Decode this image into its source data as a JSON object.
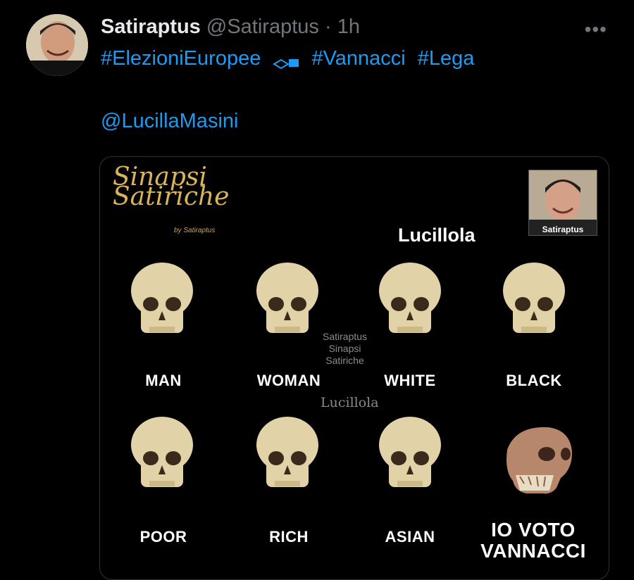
{
  "tweet": {
    "author_name": "Satiraptus",
    "author_handle": "@Satiraptus",
    "separator": "·",
    "time": "1h",
    "more_label": "•••",
    "hashtags": [
      "#ElezioniEuropee",
      "#Vannacci",
      "#Lega"
    ],
    "mention": "@LucillaMasini"
  },
  "image": {
    "logo_title": "Sinapsi Satiriche",
    "logo_line1": "Sinapsi",
    "logo_line2": "Satiriche",
    "logo_byline": "by Satiraptus",
    "header_name": "Lucillola",
    "watermark": [
      "Satiraptus",
      "Sinapsi",
      "Satiriche"
    ],
    "watermark_name": "Lucillola",
    "corner_caption": "Satiraptus",
    "labels": [
      "MAN",
      "WOMAN",
      "WHITE",
      "BLACK",
      "POOR",
      "RICH",
      "ASIAN",
      "IO VOTO VANNACCI"
    ]
  }
}
